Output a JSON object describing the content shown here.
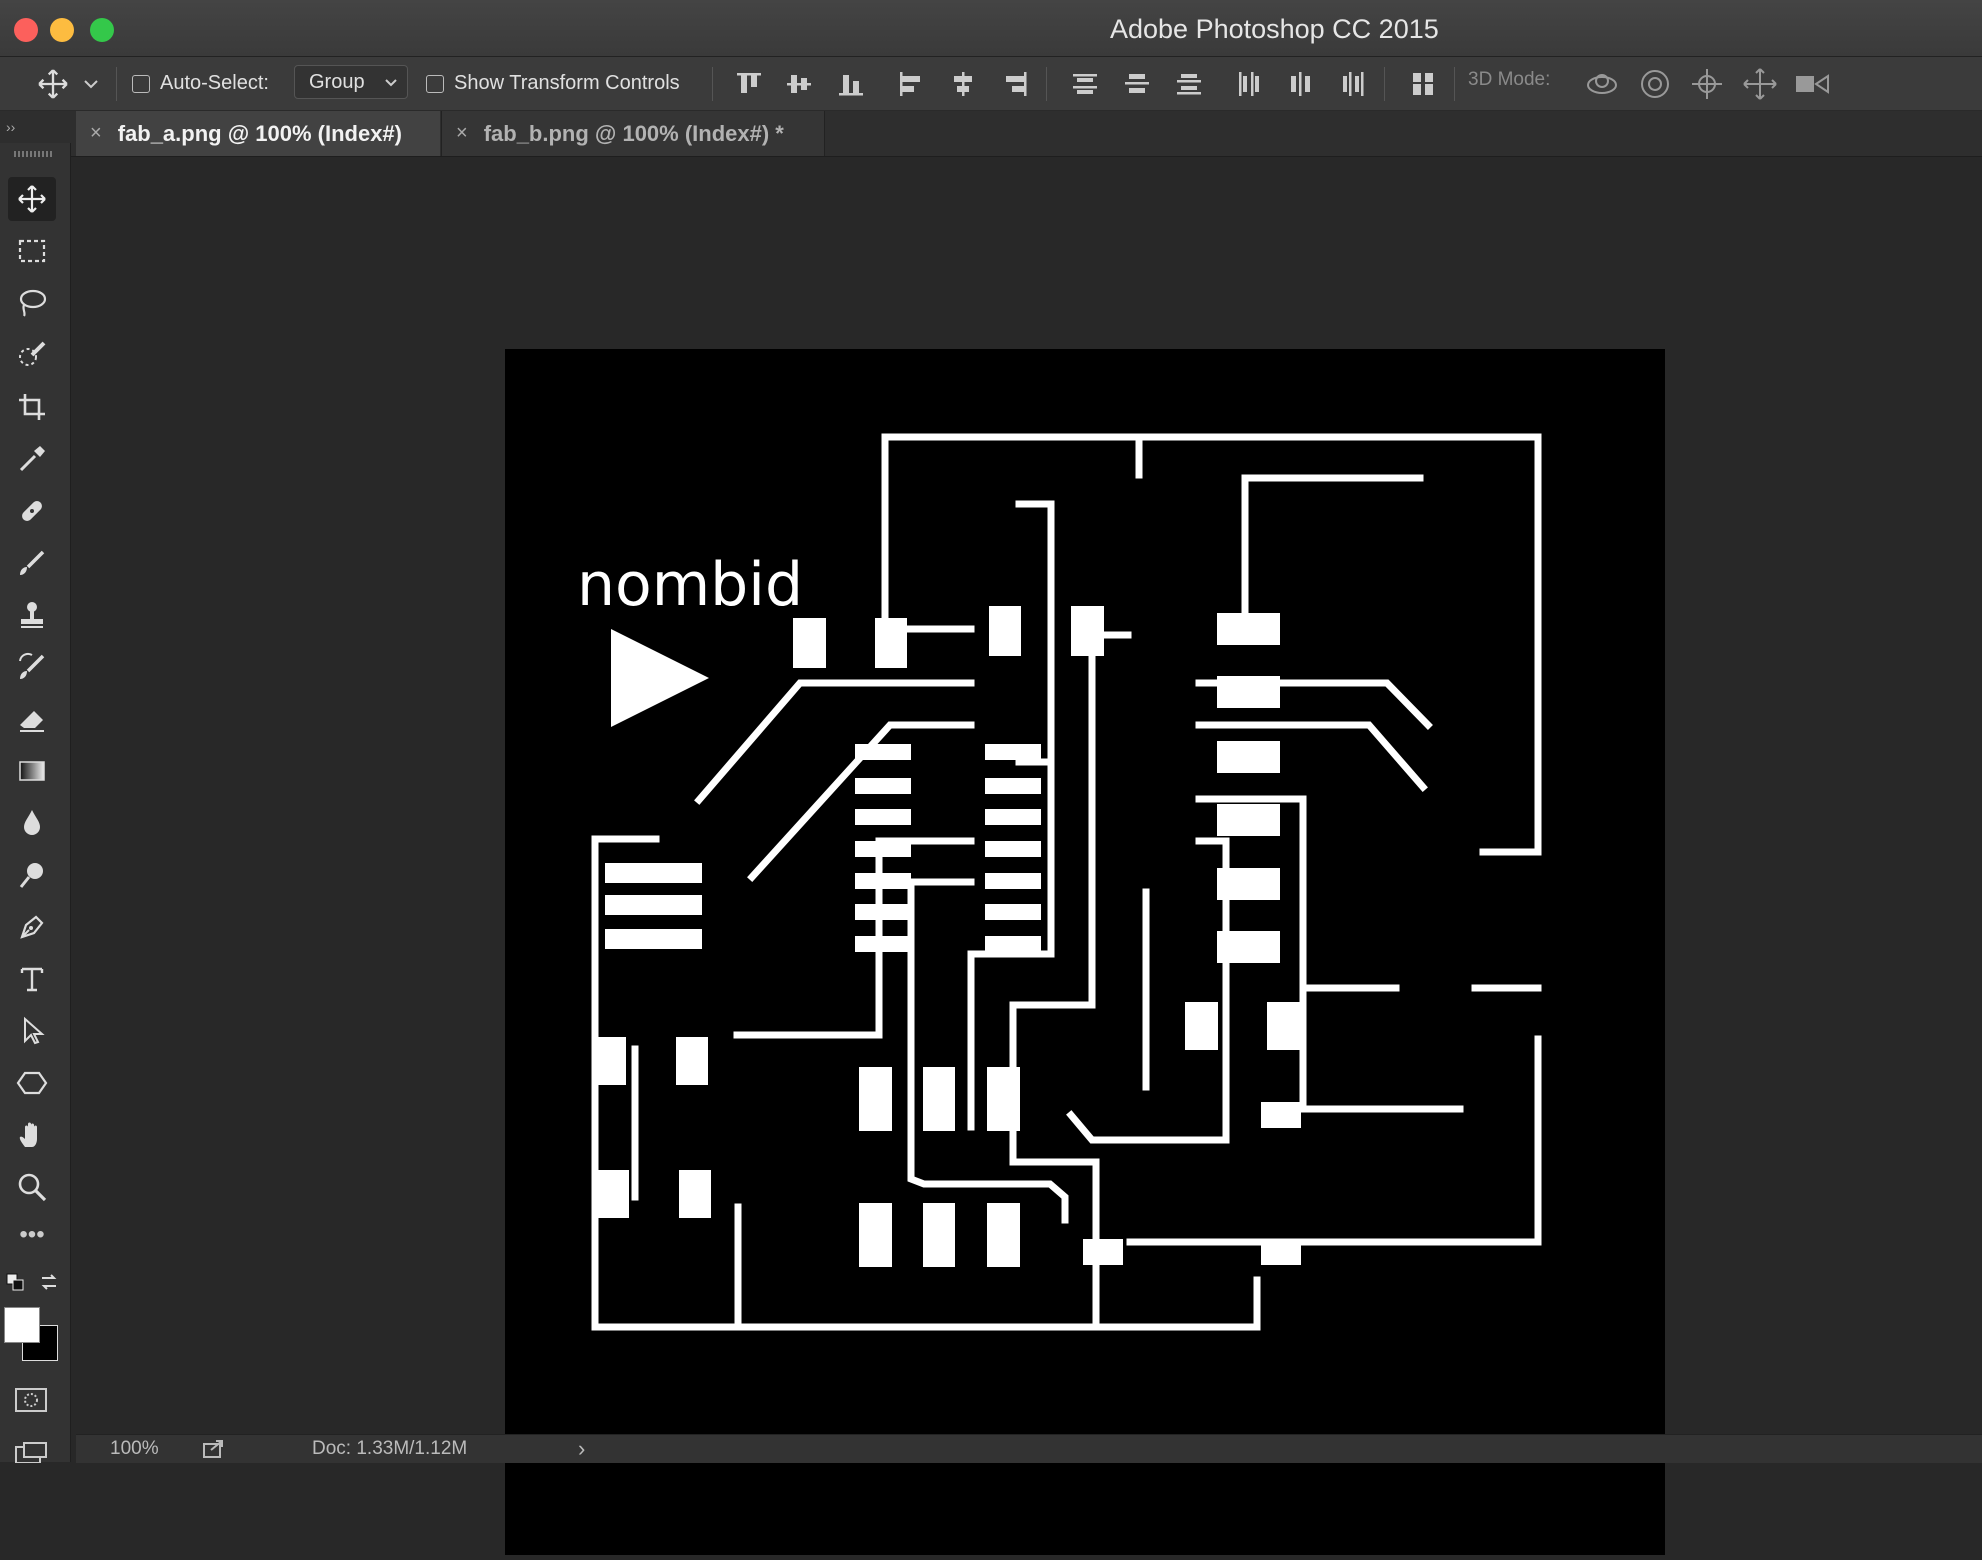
{
  "window": {
    "title": "Adobe Photoshop CC 2015"
  },
  "options_bar": {
    "auto_select_label": "Auto-Select:",
    "auto_select_value": "Group",
    "show_transform_label": "Show Transform Controls",
    "mode_3d_label": "3D Mode:"
  },
  "tabs": [
    {
      "close": "×",
      "label": "fab_a.png @ 100% (Index#)",
      "active": true
    },
    {
      "close": "×",
      "label": "fab_b.png @ 100% (Index#) *",
      "active": false
    }
  ],
  "panel_toggle": "››",
  "tools": [
    {
      "name": "move-tool",
      "active": true
    },
    {
      "name": "rectangular-marquee-tool"
    },
    {
      "name": "lasso-tool"
    },
    {
      "name": "quick-selection-tool"
    },
    {
      "name": "crop-tool"
    },
    {
      "name": "eyedropper-tool"
    },
    {
      "name": "healing-brush-tool"
    },
    {
      "name": "brush-tool"
    },
    {
      "name": "clone-stamp-tool"
    },
    {
      "name": "history-brush-tool"
    },
    {
      "name": "eraser-tool"
    },
    {
      "name": "gradient-tool"
    },
    {
      "name": "blur-tool"
    },
    {
      "name": "dodge-tool"
    },
    {
      "name": "pen-tool"
    },
    {
      "name": "type-tool"
    },
    {
      "name": "path-selection-tool"
    },
    {
      "name": "shape-tool"
    },
    {
      "name": "hand-tool"
    },
    {
      "name": "zoom-tool"
    }
  ],
  "toolbar_more": "•••",
  "colors": {
    "foreground": "#ffffff",
    "background": "#000000",
    "canvas": "#000000",
    "trace": "#ffffff"
  },
  "canvas": {
    "logo_text": "nombid"
  },
  "status": {
    "zoom": "100%",
    "doc": "Doc: 1.33M/1.12M",
    "arrow": "›"
  }
}
